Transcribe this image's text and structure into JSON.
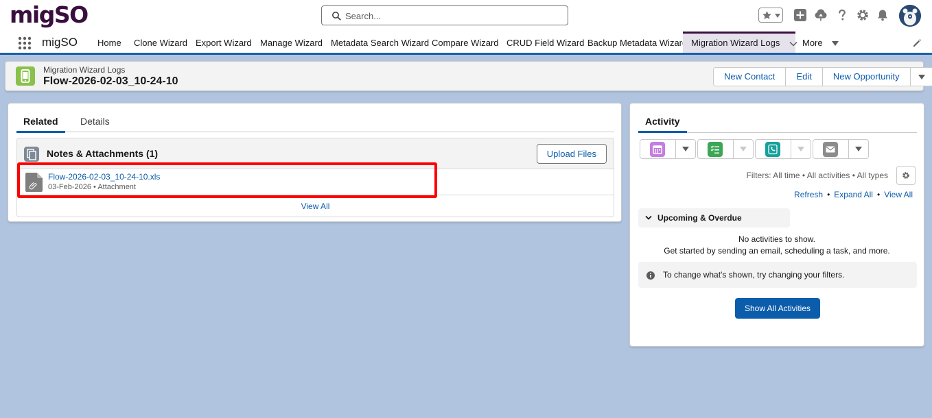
{
  "header": {
    "logo": "migSO",
    "search_placeholder": "Search...",
    "icons": [
      "star-icon",
      "chevron-down-icon",
      "plus-icon",
      "setup-tree-icon",
      "help-icon",
      "gear-icon",
      "bell-icon",
      "avatar-icon"
    ]
  },
  "nav": {
    "app_name": "migSO",
    "items": [
      "Home",
      "Clone Wizard",
      "Export Wizard",
      "Manage Wizard",
      "Metadata Search Wizard",
      "Compare Wizard",
      "CRUD Field Wizard",
      "Backup Metadata Wizard"
    ],
    "active_item": "Migration Wizard Logs",
    "more_label": "More"
  },
  "record": {
    "object_label": "Migration Wizard Logs",
    "title": "Flow-2026-02-03_10-24-10",
    "actions": [
      "New Contact",
      "Edit",
      "New Opportunity"
    ]
  },
  "related": {
    "tabs": [
      "Related",
      "Details"
    ],
    "notes": {
      "title": "Notes & Attachments (1)",
      "upload_label": "Upload Files",
      "file_name": "Flow-2026-02-03_10-24-10.xls",
      "file_meta": "03-Feb-2026 • Attachment",
      "view_all": "View All"
    }
  },
  "activity": {
    "tab": "Activity",
    "filters": "Filters: All time • All activities • All types",
    "links": [
      "Refresh",
      "Expand All",
      "View All"
    ],
    "link_separator": "•",
    "upcoming_label": "Upcoming & Overdue",
    "no_activities": "No activities to show.",
    "get_started": "Get started by sending an email, scheduling a task, and more.",
    "filter_hint": "To change what's shown, try changing your filters.",
    "show_all": "Show All Activities",
    "colors": {
      "event": "#c47de0",
      "task": "#3ba755",
      "call": "#16a19b",
      "email": "#8c8c8c"
    }
  }
}
